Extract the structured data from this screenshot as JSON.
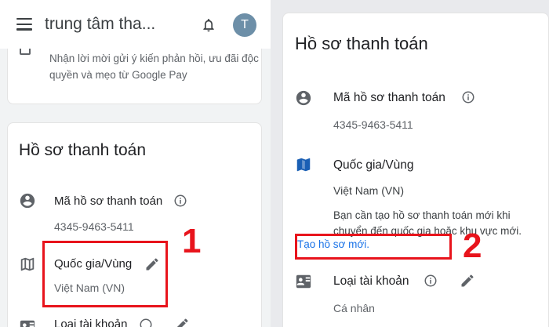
{
  "colors": {
    "accent": "#1a73e8",
    "annotation": "#e8141c",
    "avatar_bg": "#6d8fa8"
  },
  "left_panel": {
    "header": {
      "menu_icon": "menu-icon",
      "search_text": "trung tâm tha...",
      "bell_icon": "bell-icon",
      "avatar_initial": "T"
    },
    "consent": {
      "text": "Nhận lời mời gửi ý kiến phản hồi, ưu đãi độc quyền và mẹo từ Google Pay"
    },
    "profile": {
      "title": "Hồ sơ thanh toán",
      "id_label": "Mã hồ sơ thanh toán",
      "id_value": "4345-9463-5411",
      "country_label": "Quốc gia/Vùng",
      "country_value": "Việt Nam (VN)",
      "account_type_label": "Loại tài khoản"
    }
  },
  "right_panel": {
    "profile": {
      "title": "Hồ sơ thanh toán",
      "id_label": "Mã hồ sơ thanh toán",
      "id_value": "4345-9463-5411",
      "country_label": "Quốc gia/Vùng",
      "country_value": "Việt Nam (VN)",
      "notice": "Bạn cần tạo hồ sơ thanh toán mới khi chuyển đến quốc gia hoặc khu vực mới.",
      "create_link": "Tạo hồ sơ mới.",
      "account_type_label": "Loại tài khoản",
      "account_type_value": "Cá nhân"
    }
  },
  "annotations": {
    "step1": "1",
    "step2": "2"
  }
}
